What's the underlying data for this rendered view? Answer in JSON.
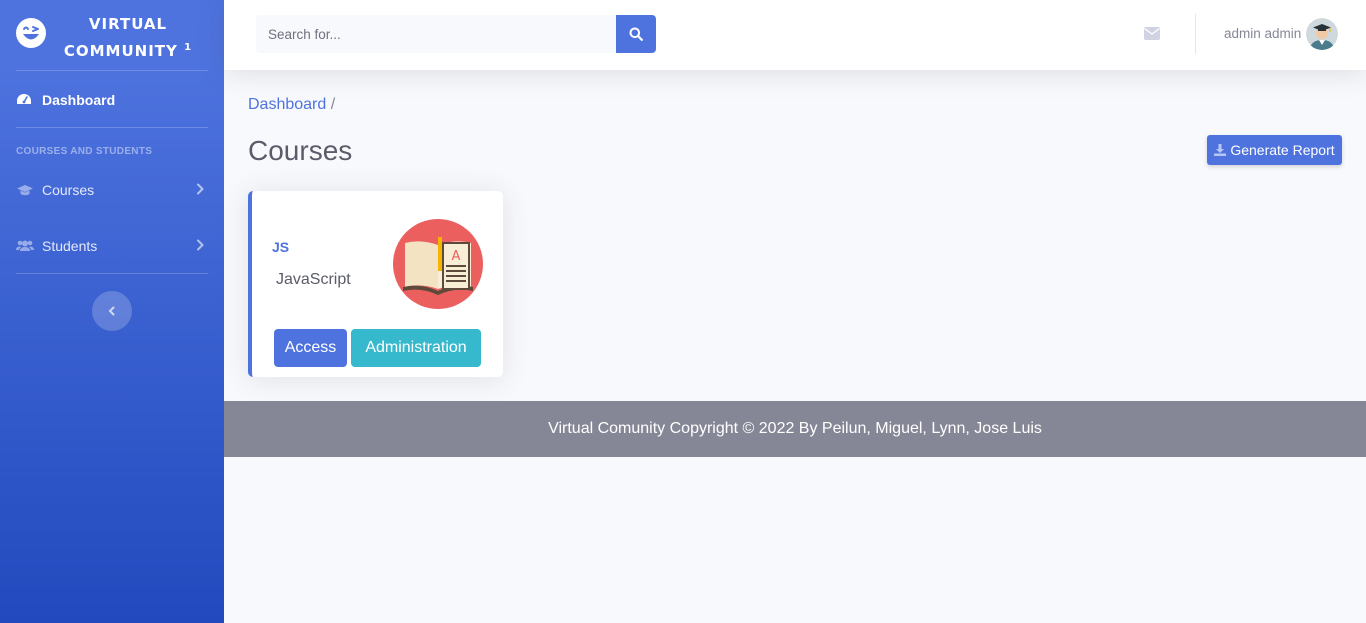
{
  "brand": {
    "line1": "VIRTUAL",
    "line2": "COMMUNITY",
    "sup": "1"
  },
  "sidebar": {
    "dashboard_label": "Dashboard",
    "heading": "COURSES AND STUDENTS",
    "items": [
      {
        "label": "Courses",
        "icon": "graduation-cap-icon"
      },
      {
        "label": "Students",
        "icon": "users-icon"
      }
    ]
  },
  "topbar": {
    "search_placeholder": "Search for...",
    "user_name": "admin admin"
  },
  "breadcrumb": {
    "home": "Dashboard",
    "separator": "/"
  },
  "page": {
    "title": "Courses",
    "report_button": "Generate Report"
  },
  "courses": [
    {
      "code": "JS",
      "name": "JavaScript",
      "access_label": "Access",
      "admin_label": "Administration"
    }
  ],
  "footer": {
    "text": "Virtual Comunity Copyright © 2022 By Peilun, Miguel, Lynn, Jose Luis"
  },
  "colors": {
    "primary": "#4e73df",
    "info": "#36b9cc",
    "footer_bg": "#858796",
    "course_image_bg": "#ec5f5f"
  }
}
